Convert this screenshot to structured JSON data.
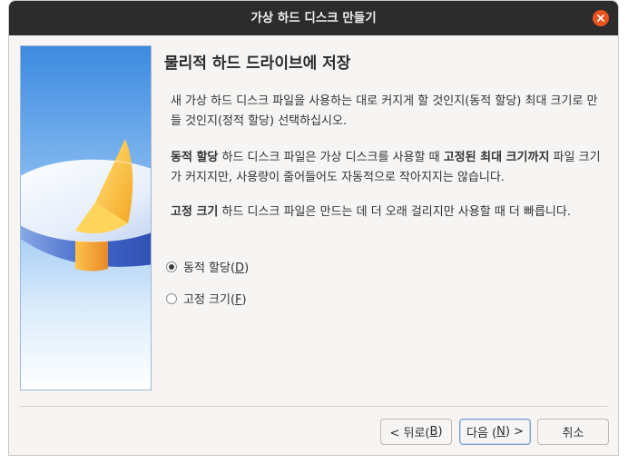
{
  "window": {
    "title": "가상 하드 디스크 만들기"
  },
  "heading": "물리적 하드 드라이브에 저장",
  "paragraphs": {
    "intro": "새 가상 하드 디스크 파일을 사용하는 대로 커지게 할 것인지(동적 할당) 최대 크기로 만들 것인지(정적 할당) 선택하십시오.",
    "dynamic_bold": "동적 할당",
    "dynamic_text1": " 하드 디스크 파일은 가상 디스크를 사용할 때 ",
    "dynamic_bold2": "고정된 최대 크기까지",
    "dynamic_text2": " 파일 크기가 커지지만, 사용량이 줄어들어도 자동적으로 작아지지는 않습니다.",
    "fixed_bold": "고정 크기",
    "fixed_text": " 하드 디스크 파일은 만드는 데 더 오래 걸리지만 사용할 때 더 빠릅니다."
  },
  "options": [
    {
      "label": "동적 할당(",
      "mnemonic": "D",
      "suffix": ")",
      "selected": true
    },
    {
      "label": "고정 크기(",
      "mnemonic": "F",
      "suffix": ")",
      "selected": false
    }
  ],
  "buttons": {
    "back": {
      "prefix": "< 뒤로(",
      "mnemonic": "B",
      "suffix": ")"
    },
    "next": {
      "prefix": "다음 (",
      "mnemonic": "N",
      "suffix": ") >"
    },
    "cancel": "취소"
  },
  "colors": {
    "titlebar": "#2c2c2c",
    "close": "#e95420",
    "background": "#f6f5f4"
  },
  "icons": {
    "close": "close-icon",
    "side_image": "disk-pie-icon"
  }
}
